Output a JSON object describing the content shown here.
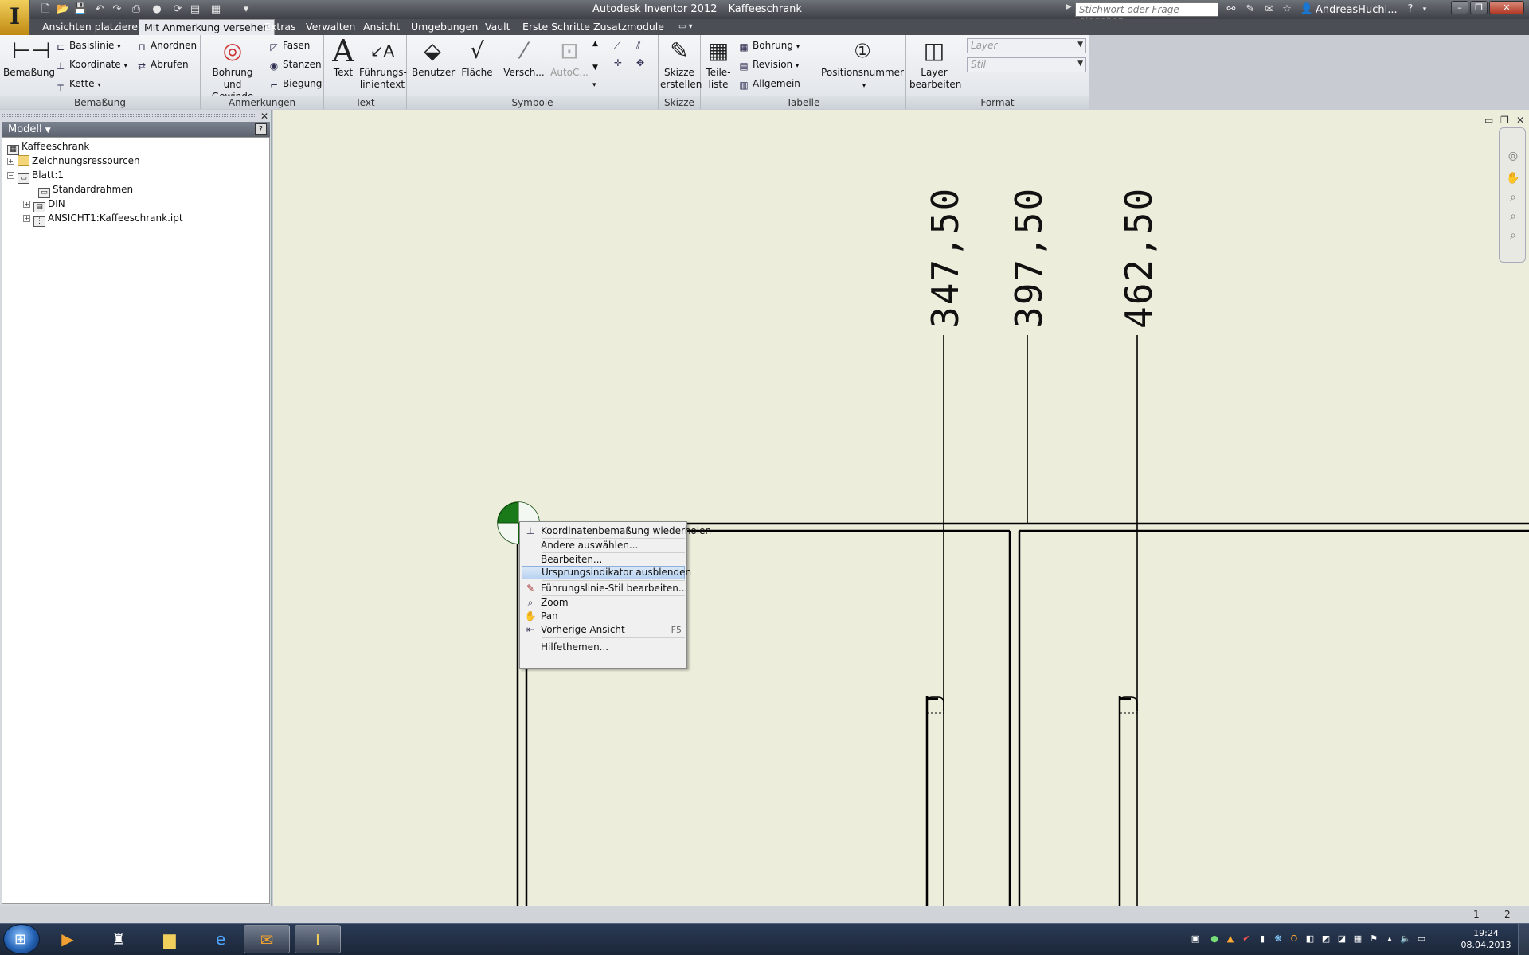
{
  "app": {
    "title": "Autodesk Inventor 2012",
    "document": "Kaffeeschrank",
    "logo_letter": "I"
  },
  "search": {
    "placeholder": "Stichwort oder Frage eingeben"
  },
  "user": {
    "name": "AndreasHuchl..."
  },
  "ribbon_tabs": [
    "Ansichten platzieren",
    "Mit Anmerkung versehen",
    "Extras",
    "Verwalten",
    "Ansicht",
    "Umgebungen",
    "Vault",
    "Erste Schritte",
    "Zusatzmodule"
  ],
  "active_tab": "Mit Anmerkung versehen",
  "ribbon": {
    "bemassung": {
      "label": "Bemaßung",
      "big_button": "Bemaßung",
      "items": [
        "Basislinie",
        "Koordinate",
        "Kette",
        "Anordnen",
        "Abrufen"
      ]
    },
    "anmerkungen": {
      "label": "Anmerkungen",
      "big_button_line1": "Bohrung und",
      "big_button_line2": "Gewinde",
      "items": [
        "Fasen",
        "Stanzen",
        "Biegung"
      ]
    },
    "text": {
      "label": "Text",
      "text_button": "Text",
      "leader_line1": "Führungs-",
      "leader_line2": "linientext"
    },
    "symbole": {
      "label": "Symbole",
      "items": [
        "Benutzer",
        "Fläche",
        "Versch...",
        "AutoC..."
      ]
    },
    "skizze": {
      "label": "Skizze",
      "line1": "Skizze",
      "line2": "erstellen"
    },
    "tabelle": {
      "label": "Tabelle",
      "parts_line1": "Teile-",
      "parts_line2": "liste",
      "items": [
        "Bohrung",
        "Revision",
        "Allgemein"
      ],
      "position_number": "Positionsnummer"
    },
    "format": {
      "label": "Format",
      "layer_line1": "Layer",
      "layer_line2": "bearbeiten",
      "layer_combo": "Layer",
      "style_combo": "Stil"
    }
  },
  "browser": {
    "title": "Modell",
    "help": "?",
    "tree": [
      {
        "label": "Kaffeeschrank"
      },
      {
        "label": "Zeichnungsressourcen"
      },
      {
        "label": "Blatt:1"
      },
      {
        "label": "Standardrahmen"
      },
      {
        "label": "DIN"
      },
      {
        "label": "ANSICHT1:Kaffeeschrank.ipt"
      }
    ]
  },
  "drawing": {
    "dimensions": [
      "347,50",
      "397,50",
      "462,50"
    ]
  },
  "context_menu": {
    "items": [
      {
        "label": "Koordinatenbemaßung wiederholen",
        "shortcut": ""
      },
      {
        "label": "Andere auswählen...",
        "shortcut": ""
      },
      {
        "label": "Bearbeiten...",
        "shortcut": ""
      },
      {
        "label": "Ursprungsindikator ausblenden",
        "shortcut": ""
      },
      {
        "label": "Führungslinie-Stil bearbeiten...",
        "shortcut": ""
      },
      {
        "label": "Zoom",
        "shortcut": ""
      },
      {
        "label": "Pan",
        "shortcut": ""
      },
      {
        "label": "Vorherige Ansicht",
        "shortcut": "F5"
      },
      {
        "label": "Hilfethemen...",
        "shortcut": ""
      }
    ],
    "highlighted": "Ursprungsindikator ausblenden"
  },
  "statusbar": {
    "page1": "1",
    "page2": "2"
  },
  "taskbar": {
    "time": "19:24",
    "date": "08.04.2013"
  },
  "colors": {
    "canvas_bg": "#ededdb",
    "origin_indicator": "#1a7a1a",
    "menu_highlight": "#b8d2f0"
  }
}
